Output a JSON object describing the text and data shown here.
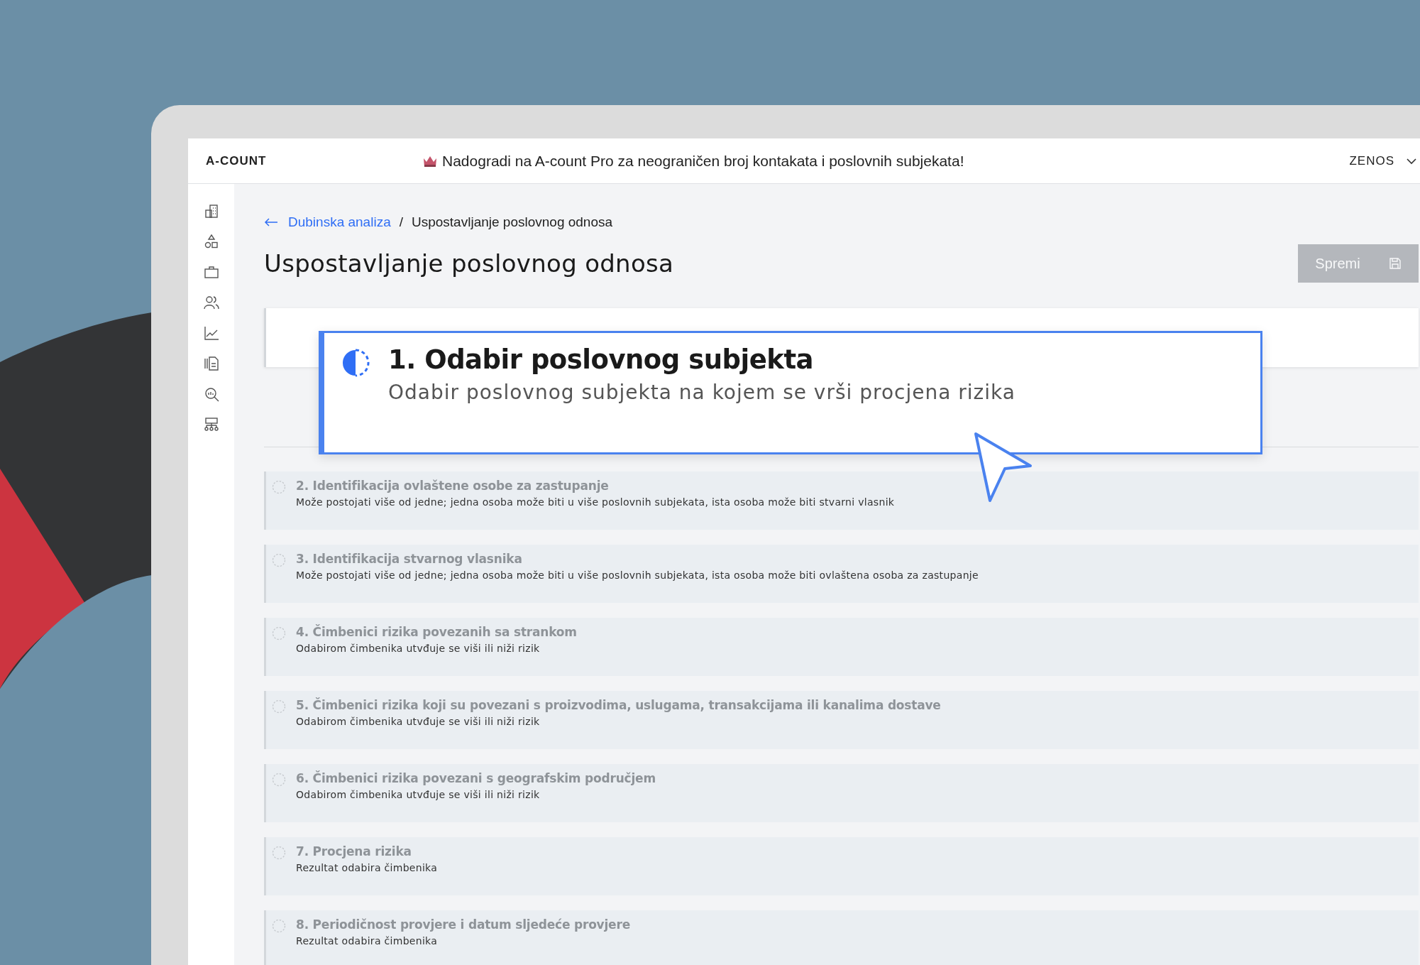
{
  "header": {
    "logo": "A-COUNT",
    "banner": "Nadogradi na A-count Pro za neograničen broj kontakata i poslovnih subjekata!",
    "user": "ZENOS"
  },
  "breadcrumb": {
    "back": "Dubinska analiza",
    "separator": "/",
    "current": "Uspostavljanje poslovnog odnosa"
  },
  "title": "Uspostavljanje poslovnog odnosa",
  "save_button": {
    "label": "Spremi",
    "disabled": true
  },
  "callout": {
    "title": "1. Odabir poslovnog subjekta",
    "description": "Odabir poslovnog subjekta na kojem se vrši procjena rizika",
    "active": true
  },
  "steps": [
    {
      "title": "2. Identifikacija ovlaštene osobe za zastupanje",
      "description": "Može postojati više od jedne; jedna osoba može biti u više poslovnih subjekata, ista osoba može biti stvarni vlasnik",
      "active": false
    },
    {
      "title": "3. Identifikacija stvarnog vlasnika",
      "description": "Može postojati više od jedne; jedna osoba može biti u više poslovnih subjekata, ista osoba može biti ovlaštena osoba za zastupanje",
      "active": false
    },
    {
      "title": "4. Čimbenici rizika povezanih sa strankom",
      "description": "Odabirom čimbenika utvđuje se viši ili niži rizik",
      "active": false
    },
    {
      "title": "5. Čimbenici rizika koji su povezani s proizvodima, uslugama, transakcijama ili kanalima dostave",
      "description": "Odabirom čimbenika utvđuje se viši ili niži rizik",
      "active": false
    },
    {
      "title": "6. Čimbenici rizika povezani s geografskim područjem",
      "description": "Odabirom čimbenika utvđuje se viši ili niži rizik",
      "active": false
    },
    {
      "title": "7. Procjena rizika",
      "description": "Rezultat odabira čimbenika",
      "active": false
    },
    {
      "title": "8. Periodičnost provjere i datum sljedeće provjere",
      "description": "Rezultat odabira čimbenika",
      "active": false
    }
  ]
}
